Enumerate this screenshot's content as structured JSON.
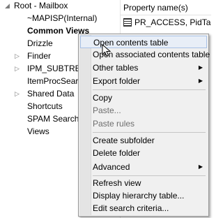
{
  "tree": {
    "items": [
      {
        "label": "Root - Mailbox",
        "bold": false,
        "expander": "◢"
      },
      {
        "label": "~MAPISP(Internal)",
        "bold": false,
        "expander": ""
      },
      {
        "label": "Common Views",
        "bold": true,
        "expander": ""
      },
      {
        "label": "Drizzle",
        "bold": false,
        "expander": ""
      },
      {
        "label": "Finder",
        "bold": false,
        "expander": "▷"
      },
      {
        "label": "IPM_SUBTREE",
        "bold": false,
        "expander": "▷"
      },
      {
        "label": "ItemProcSearch",
        "bold": false,
        "expander": ""
      },
      {
        "label": "Shared Data",
        "bold": false,
        "expander": "▷"
      },
      {
        "label": "Shortcuts",
        "bold": false,
        "expander": ""
      },
      {
        "label": "SPAM Search",
        "bold": false,
        "expander": ""
      },
      {
        "label": "Views",
        "bold": false,
        "expander": ""
      }
    ]
  },
  "properties": {
    "column_header": "Property name(s)",
    "rows": [
      {
        "text": "PR_ACCESS, PidTagAccess",
        "icon": "grid-icon"
      }
    ]
  },
  "context_menu": {
    "items": [
      {
        "label": "Open contents table",
        "disabled": false,
        "submenu": false,
        "highlighted": true
      },
      {
        "label": "Open associated contents table",
        "disabled": false,
        "submenu": false,
        "highlighted": false
      },
      {
        "label": "Other tables",
        "disabled": false,
        "submenu": true,
        "highlighted": false
      },
      {
        "label": "Export folder",
        "disabled": false,
        "submenu": true,
        "highlighted": false
      },
      {
        "separator": true
      },
      {
        "label": "Copy",
        "disabled": false,
        "submenu": false,
        "highlighted": false
      },
      {
        "label": "Paste...",
        "disabled": true,
        "submenu": false,
        "highlighted": false
      },
      {
        "label": "Paste rules",
        "disabled": true,
        "submenu": false,
        "highlighted": false
      },
      {
        "separator": true
      },
      {
        "label": "Create subfolder",
        "disabled": false,
        "submenu": false,
        "highlighted": false
      },
      {
        "label": "Delete folder",
        "disabled": false,
        "submenu": false,
        "highlighted": false
      },
      {
        "label": "Advanced",
        "disabled": false,
        "submenu": true,
        "highlighted": false
      },
      {
        "separator": true
      },
      {
        "label": "Refresh view",
        "disabled": false,
        "submenu": false,
        "highlighted": false
      },
      {
        "label": "Display hierarchy table...",
        "disabled": false,
        "submenu": false,
        "highlighted": false
      },
      {
        "label": "Edit search criteria...",
        "disabled": false,
        "submenu": false,
        "highlighted": false
      }
    ],
    "submenu_arrow": "▶"
  },
  "colors": {
    "menu_background": "#f0f0f0",
    "menu_highlight": "#e8eef7",
    "menu_highlight_border": "#a8c1e6",
    "disabled_text": "#6d6d6d"
  }
}
